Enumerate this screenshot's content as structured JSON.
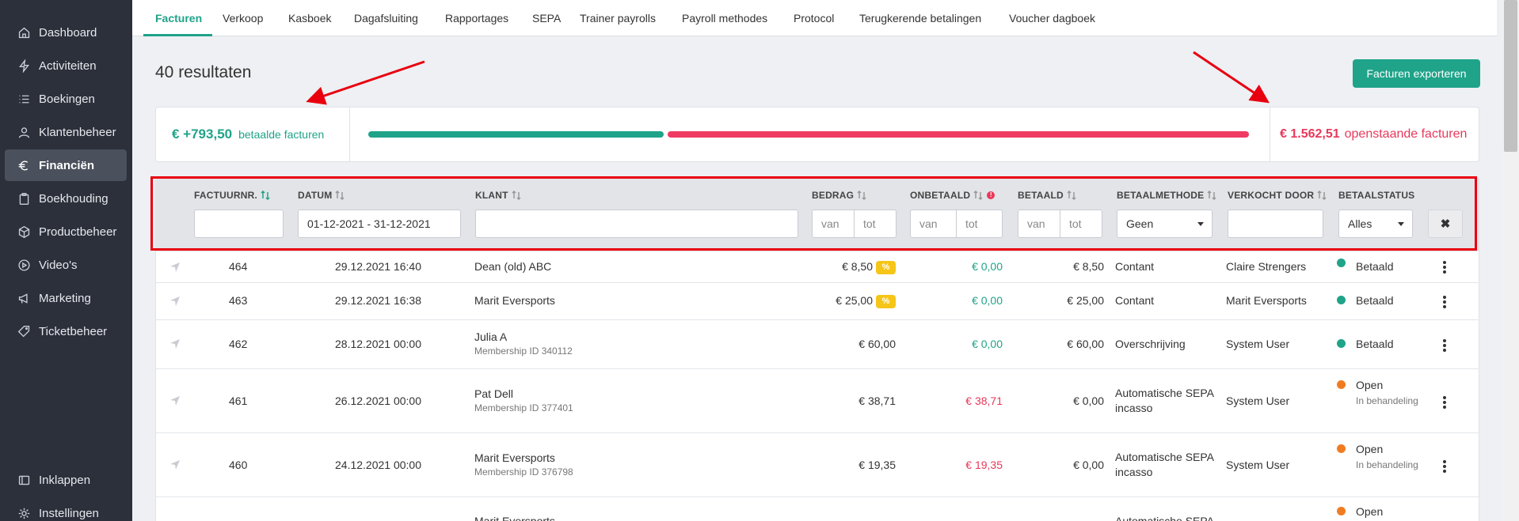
{
  "sidebar": {
    "items": [
      {
        "label": "Dashboard",
        "icon": "home-icon"
      },
      {
        "label": "Activiteiten",
        "icon": "lightning-icon"
      },
      {
        "label": "Boekingen",
        "icon": "list-icon"
      },
      {
        "label": "Klantenbeheer",
        "icon": "user-icon"
      },
      {
        "label": "Financiën",
        "icon": "euro-icon"
      },
      {
        "label": "Boekhouding",
        "icon": "clipboard-icon"
      },
      {
        "label": "Productbeheer",
        "icon": "box-icon"
      },
      {
        "label": "Video's",
        "icon": "play-icon"
      },
      {
        "label": "Marketing",
        "icon": "megaphone-icon"
      },
      {
        "label": "Ticketbeheer",
        "icon": "tag-icon"
      }
    ],
    "collapse_label": "Inklappen",
    "settings_label": "Instellingen"
  },
  "tabs": [
    "Facturen",
    "Verkoop",
    "Kasboek",
    "Dagafsluiting",
    "Rapportages",
    "SEPA",
    "Trainer payrolls",
    "Payroll methodes",
    "Protocol",
    "Terugkerende betalingen",
    "Voucher dagboek"
  ],
  "results_title": "40 resultaten",
  "export_label": "Facturen exporteren",
  "summary": {
    "paid_amount": "€ +793,50",
    "paid_label": "betaalde facturen",
    "open_amount": "€ 1.562,51",
    "open_label": "openstaande facturen"
  },
  "filters": {
    "headers": [
      "FACTUURNR.",
      "DATUM",
      "KLANT",
      "BEDRAG",
      "ONBETAALD",
      "BETAALD",
      "BETAALMETHODE",
      "VERKOCHT DOOR",
      "BETAALSTATUS"
    ],
    "date_value": "01-12-2021 - 31-12-2021",
    "from_placeholder": "van",
    "to_placeholder": "tot",
    "method_value": "Geen",
    "status_value": "Alles",
    "clear_label": "✖"
  },
  "rows": [
    {
      "nr": "464",
      "date": "29.12.2021 16:40",
      "client": "Dean (old) ABC",
      "sub": "",
      "amount": "€ 8,50",
      "badge": "%",
      "unpaid": "€ 0,00",
      "unpaid_state": "zero",
      "paid": "€ 8,50",
      "method": "Contant",
      "method2": "",
      "seller": "Claire Strengers",
      "status": "Betaald",
      "status2": "",
      "state": "paid"
    },
    {
      "nr": "463",
      "date": "29.12.2021 16:38",
      "client": "Marit Eversports",
      "sub": "",
      "amount": "€ 25,00",
      "badge": "%",
      "unpaid": "€ 0,00",
      "unpaid_state": "zero",
      "paid": "€ 25,00",
      "method": "Contant",
      "method2": "",
      "seller": "Marit Eversports",
      "status": "Betaald",
      "status2": "",
      "state": "paid"
    },
    {
      "nr": "462",
      "date": "28.12.2021 00:00",
      "client": "Julia A",
      "sub": "Membership ID 340112",
      "amount": "€ 60,00",
      "badge": "",
      "unpaid": "€ 0,00",
      "unpaid_state": "zero",
      "paid": "€ 60,00",
      "method": "Overschrijving",
      "method2": "",
      "seller": "System User",
      "status": "Betaald",
      "status2": "",
      "state": "paid"
    },
    {
      "nr": "461",
      "date": "26.12.2021 00:00",
      "client": "Pat Dell",
      "sub": "Membership ID 377401",
      "amount": "€ 38,71",
      "badge": "",
      "unpaid": "€ 38,71",
      "unpaid_state": "due",
      "paid": "€ 0,00",
      "method": "Automatische SEPA",
      "method2": "incasso",
      "seller": "System User",
      "status": "Open",
      "status2": "In behandeling",
      "state": "open"
    },
    {
      "nr": "460",
      "date": "24.12.2021 00:00",
      "client": "Marit Eversports",
      "sub": "Membership ID 376798",
      "amount": "€ 19,35",
      "badge": "",
      "unpaid": "€ 19,35",
      "unpaid_state": "due",
      "paid": "€ 0,00",
      "method": "Automatische SEPA",
      "method2": "incasso",
      "seller": "System User",
      "status": "Open",
      "status2": "In behandeling",
      "state": "open"
    },
    {
      "nr": "",
      "date": "",
      "client": "Marit Eversports",
      "sub": "",
      "amount": "",
      "badge": "",
      "unpaid": "",
      "unpaid_state": "zero",
      "paid": "",
      "method": "Automatische SEPA",
      "method2": "",
      "seller": "",
      "status": "Open",
      "status2": "",
      "state": "open"
    }
  ],
  "colors": {
    "accent": "#1fa389",
    "danger": "#e8385a",
    "sidebar": "#2b303b",
    "warning": "#f07c22",
    "badge": "#f5c518"
  }
}
